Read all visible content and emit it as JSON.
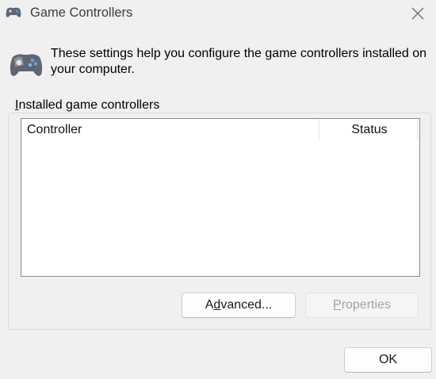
{
  "window": {
    "title": "Game Controllers",
    "icon": "gamepad-icon",
    "close_icon": "close-icon"
  },
  "intro": {
    "icon": "gamepad-icon",
    "text": "These settings help you configure the game controllers installed on your computer."
  },
  "installed": {
    "label_first": "I",
    "label_rest": "nstalled game controllers",
    "columns": [
      "Controller",
      "Status"
    ],
    "rows": []
  },
  "buttons": {
    "advanced": {
      "pre": "A",
      "mnemonic": "d",
      "post": "vanced...",
      "enabled": true
    },
    "properties": {
      "pre": "",
      "mnemonic": "P",
      "post": "roperties",
      "enabled": false
    },
    "ok": {
      "label": "OK",
      "enabled": true
    }
  },
  "colors": {
    "background": "#f0f0f0",
    "list_background": "#ffffff",
    "disabled_text": "#a3a3a3",
    "icon_accent": "#5aa0d8"
  }
}
